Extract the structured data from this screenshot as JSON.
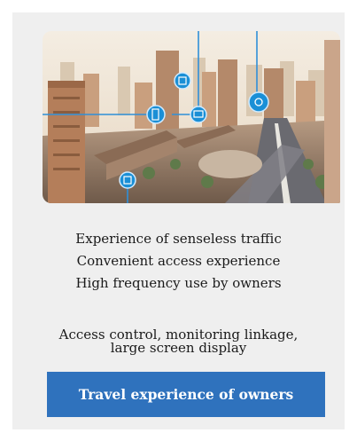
{
  "features": [
    "Experience of senseless traffic",
    "Convenient access experience",
    "High frequency use by owners"
  ],
  "capabilities": {
    "line1": "Access control, monitoring linkage,",
    "line2": "large screen display"
  },
  "cta_label": "Travel experience of owners",
  "colors": {
    "card_bg": "#efefef",
    "button_bg": "#2f72bd",
    "icon_marker": "#1a8fd6"
  },
  "hero_icons": [
    "doorbell-icon",
    "door-icon",
    "monitor-icon",
    "camera-icon",
    "gate-icon"
  ]
}
